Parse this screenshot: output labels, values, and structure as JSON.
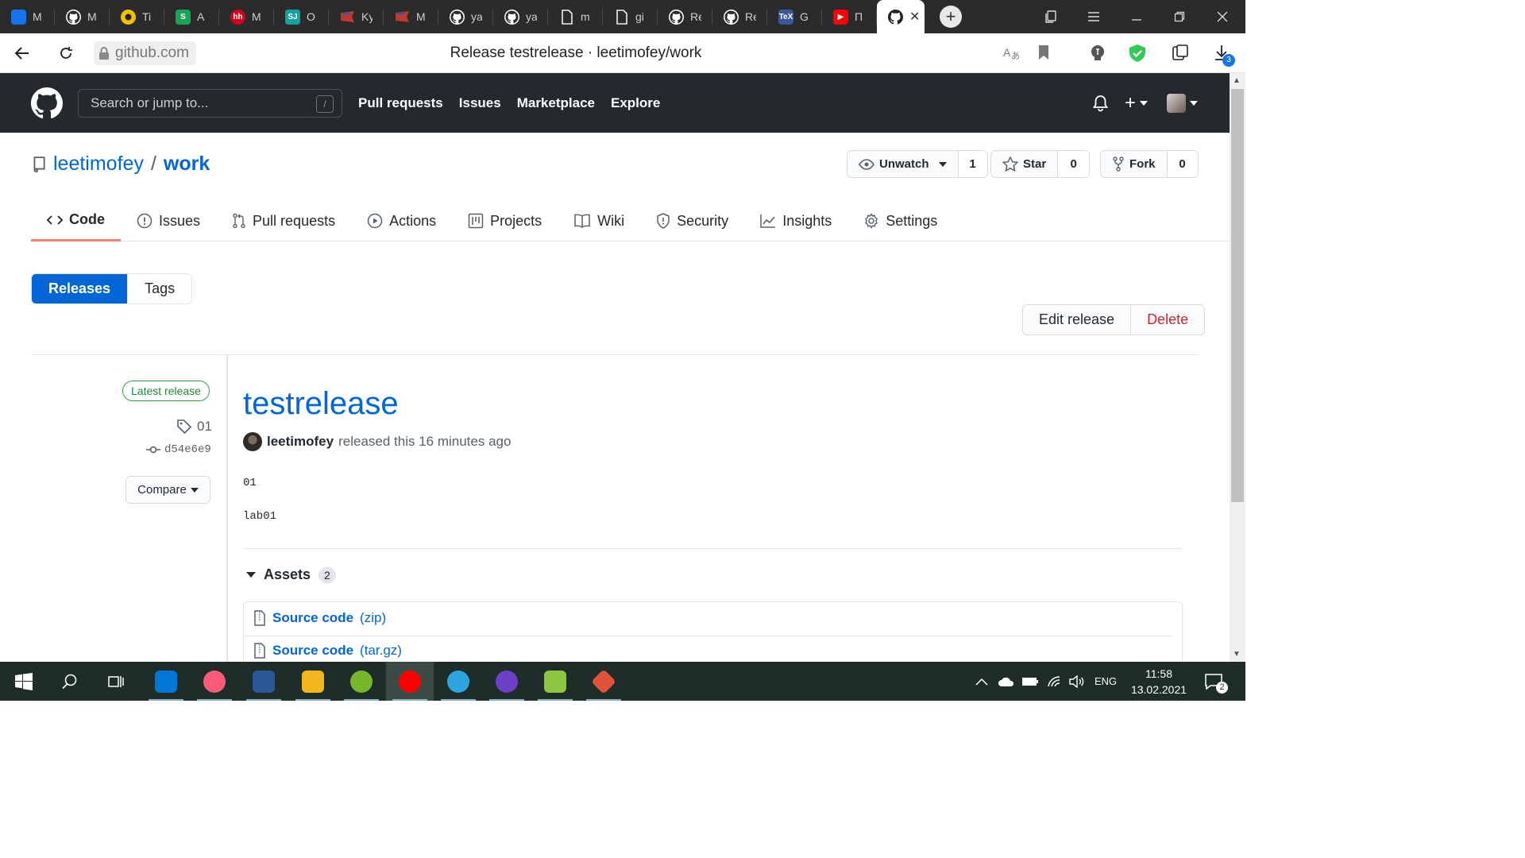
{
  "browser": {
    "tabs": [
      {
        "label": "M",
        "icon": "chat-icon",
        "color": "#1a73e8",
        "glyph": ""
      },
      {
        "label": "M",
        "icon": "github-icon",
        "color": "#2b2b2b",
        "glyph": ""
      },
      {
        "label": "Ti",
        "icon": "seal-icon",
        "color": "#f2c200",
        "glyph": ""
      },
      {
        "label": "A",
        "icon": "dollar-icon",
        "color": "#18a558",
        "glyph": "S"
      },
      {
        "label": "M",
        "icon": "hh-icon",
        "color": "#d6001c",
        "glyph": "hh"
      },
      {
        "label": "O",
        "icon": "sj-icon",
        "color": "#16a0a0",
        "glyph": "SJ"
      },
      {
        "label": "Ky",
        "icon": "flag-icon",
        "color": "#c0392b",
        "glyph": ""
      },
      {
        "label": "M",
        "icon": "flag-icon",
        "color": "#c0392b",
        "glyph": ""
      },
      {
        "label": "ya",
        "icon": "github-icon",
        "color": "#2b2b2b",
        "glyph": ""
      },
      {
        "label": "ya",
        "icon": "github-icon",
        "color": "#2b2b2b",
        "glyph": ""
      },
      {
        "label": "m",
        "icon": "document-icon",
        "color": "#2b2b2b",
        "glyph": ""
      },
      {
        "label": "gi",
        "icon": "document-icon",
        "color": "#2b2b2b",
        "glyph": ""
      },
      {
        "label": "Re",
        "icon": "github-icon",
        "color": "#2b2b2b",
        "glyph": ""
      },
      {
        "label": "Re",
        "icon": "github-icon",
        "color": "#2b2b2b",
        "glyph": ""
      },
      {
        "label": "G",
        "icon": "tex-icon",
        "color": "#3b5998",
        "glyph": "TeX"
      },
      {
        "label": "П",
        "icon": "youtube-icon",
        "color": "#ff0000",
        "glyph": "▶"
      }
    ],
    "active_tab_close": "✕",
    "url": "github.com",
    "page_title": "Release testrelease · leetimofey/work",
    "downloads_count": "3"
  },
  "github": {
    "search_placeholder": "Search or jump to...",
    "search_shortcut": "/",
    "nav": [
      "Pull requests",
      "Issues",
      "Marketplace",
      "Explore"
    ],
    "plus": "+"
  },
  "repo": {
    "owner": "leetimofey",
    "separator": "/",
    "name": "work",
    "watch_label": "Unwatch",
    "watch_count": "1",
    "star_label": "Star",
    "star_count": "0",
    "fork_label": "Fork",
    "fork_count": "0",
    "tabs": [
      "Code",
      "Issues",
      "Pull requests",
      "Actions",
      "Projects",
      "Wiki",
      "Security",
      "Insights",
      "Settings"
    ],
    "selected_tab": "Code"
  },
  "releases": {
    "subnav_releases": "Releases",
    "subnav_tags": "Tags",
    "edit_label": "Edit release",
    "delete_label": "Delete",
    "latest_badge": "Latest release",
    "tag": "01",
    "commit": "d54e6e9",
    "compare_label": "Compare",
    "title": "testrelease",
    "author": "leetimofey",
    "released_text": "released this 16 minutes ago",
    "notes": [
      "01",
      "lab01"
    ],
    "assets_label": "Assets",
    "assets_count": "2",
    "assets": [
      {
        "name": "Source code",
        "kind": "(zip)"
      },
      {
        "name": "Source code",
        "kind": "(tar.gz)"
      }
    ]
  },
  "taskbar": {
    "apps": [
      {
        "name": "store",
        "color": "#0078d7"
      },
      {
        "name": "itunes",
        "color": "#fa5b78"
      },
      {
        "name": "word",
        "color": "#2b579a"
      },
      {
        "name": "file-explorer",
        "color": "#f2b81b"
      },
      {
        "name": "utorrent",
        "color": "#76b82a"
      },
      {
        "name": "yandex-browser",
        "color": "#ff0000"
      },
      {
        "name": "telegram",
        "color": "#2ca5e0"
      },
      {
        "name": "github-desktop",
        "color": "#6e40c9"
      },
      {
        "name": "notepad-plus",
        "color": "#8dc63f"
      },
      {
        "name": "git-extensions",
        "color": "#e0533a"
      }
    ],
    "language": "ENG",
    "time": "11:58",
    "date": "13.02.2021",
    "notifications": "2"
  }
}
